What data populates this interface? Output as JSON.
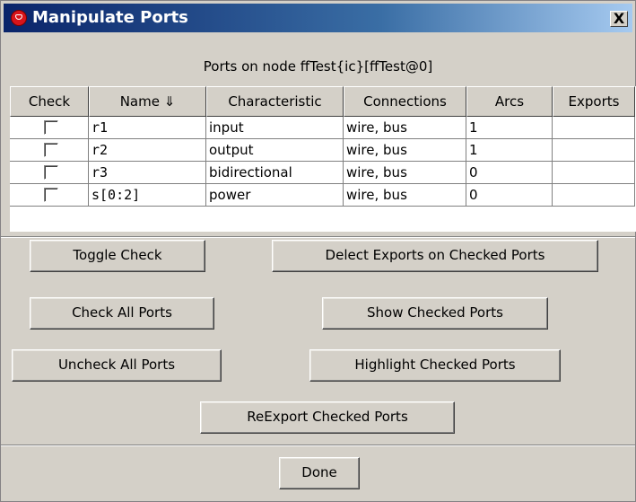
{
  "window": {
    "title": "Manipulate Ports",
    "close_label": "X"
  },
  "subtitle": "Ports on node ffTest{ic}[ffTest@0]",
  "table": {
    "columns": [
      "Check",
      "Name ⇓",
      "Characteristic",
      "Connections",
      "Arcs",
      "Exports"
    ],
    "rows": [
      {
        "checked": false,
        "name": "r1",
        "characteristic": "input",
        "connections": "wire, bus",
        "arcs": "1",
        "exports": ""
      },
      {
        "checked": false,
        "name": "r2",
        "characteristic": "output",
        "connections": "wire, bus",
        "arcs": "1",
        "exports": ""
      },
      {
        "checked": false,
        "name": "r3",
        "characteristic": "bidirectional",
        "connections": "wire, bus",
        "arcs": "0",
        "exports": ""
      },
      {
        "checked": false,
        "name": "s[0:2]",
        "characteristic": "power",
        "connections": "wire, bus",
        "arcs": "0",
        "exports": ""
      }
    ]
  },
  "buttons": {
    "toggle_check": "Toggle Check",
    "delect_exports": "Delect Exports on Checked Ports",
    "check_all": "Check All Ports",
    "show_checked": "Show Checked Ports",
    "uncheck_all": "Uncheck All Ports",
    "highlight_checked": "Highlight Checked Ports",
    "reexport_checked": "ReExport Checked Ports",
    "done": "Done"
  },
  "icons": {
    "app": "electric-app-icon",
    "close": "close-icon",
    "sort": "sort-descending-icon"
  }
}
